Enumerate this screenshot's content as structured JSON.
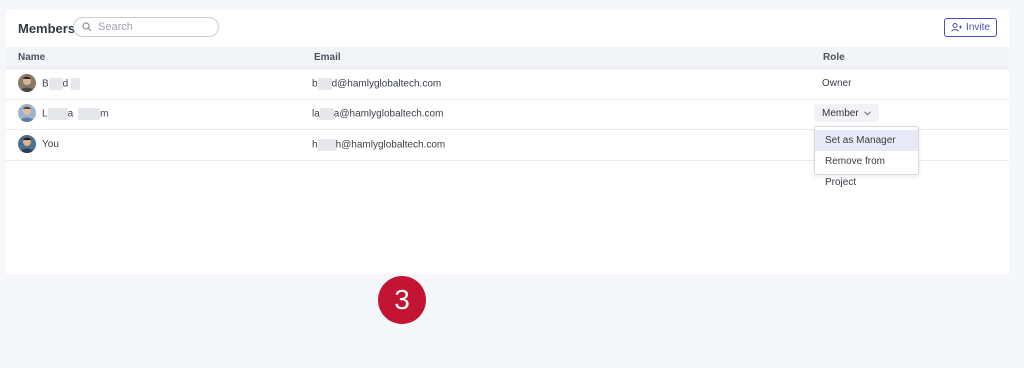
{
  "header": {
    "title": "Members",
    "search_placeholder": "Search",
    "invite_label": "Invite"
  },
  "table": {
    "columns": [
      "Name",
      "Email",
      "Role"
    ],
    "rows": [
      {
        "name_start": "B",
        "name_mid": "d",
        "email_start": "b",
        "email_end": "d@hamlyglobaltech.com",
        "role": "Owner"
      },
      {
        "name_start": "L",
        "name_mid": "a",
        "name_end": "m",
        "email_start": "la",
        "email_end": "a@hamlyglobaltech.com",
        "role": "Member"
      },
      {
        "name": "You",
        "email_start": "h",
        "email_end": "h@hamlyglobaltech.com"
      }
    ]
  },
  "role_menu": {
    "options": [
      "Set as Manager",
      "Remove from Project"
    ],
    "highlighted": "Set as Manager"
  },
  "step_badge": "3",
  "colors": {
    "accent": "#4a4fb8",
    "badge": "#c41434",
    "header_bg": "#f2f4f7"
  }
}
